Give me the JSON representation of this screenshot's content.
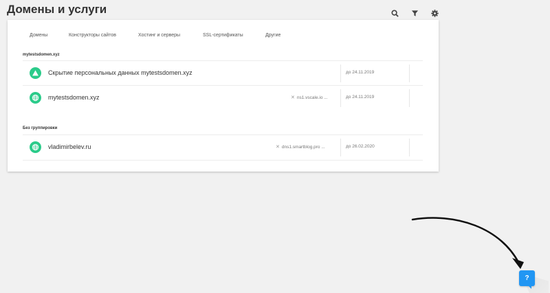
{
  "header": {
    "title": "Домены и услуги",
    "icons": [
      "search-icon",
      "filter-icon",
      "gear-icon"
    ]
  },
  "tabs": [
    {
      "label": "Домены"
    },
    {
      "label": "Конструкторы сайтов"
    },
    {
      "label": "Хостинг и серверы"
    },
    {
      "label": "SSL-сертификаты"
    },
    {
      "label": "Другие"
    }
  ],
  "groups": [
    {
      "label": "mytestsdomen.xyz",
      "rows": [
        {
          "icon": "shield-triangle-icon",
          "name": "Скрытие персональных данных mytestsdomen.xyz",
          "ns": "",
          "date": "до 24.11.2019"
        },
        {
          "icon": "globe-icon",
          "name": "mytestsdomen.xyz",
          "ns": "ns1.vscale.io ...",
          "date": "до 24.11.2019"
        }
      ]
    },
    {
      "label": "Без группировки",
      "rows": [
        {
          "icon": "globe-icon",
          "name": "vladimirbelev.ru",
          "ns": "dns1.smartblog.pro ...",
          "date": "до 26.02.2020"
        }
      ]
    }
  ],
  "help": {
    "label": "?"
  },
  "colors": {
    "accent": "#2bcb8a",
    "help": "#2196f3",
    "background": "#f1f1f1"
  }
}
